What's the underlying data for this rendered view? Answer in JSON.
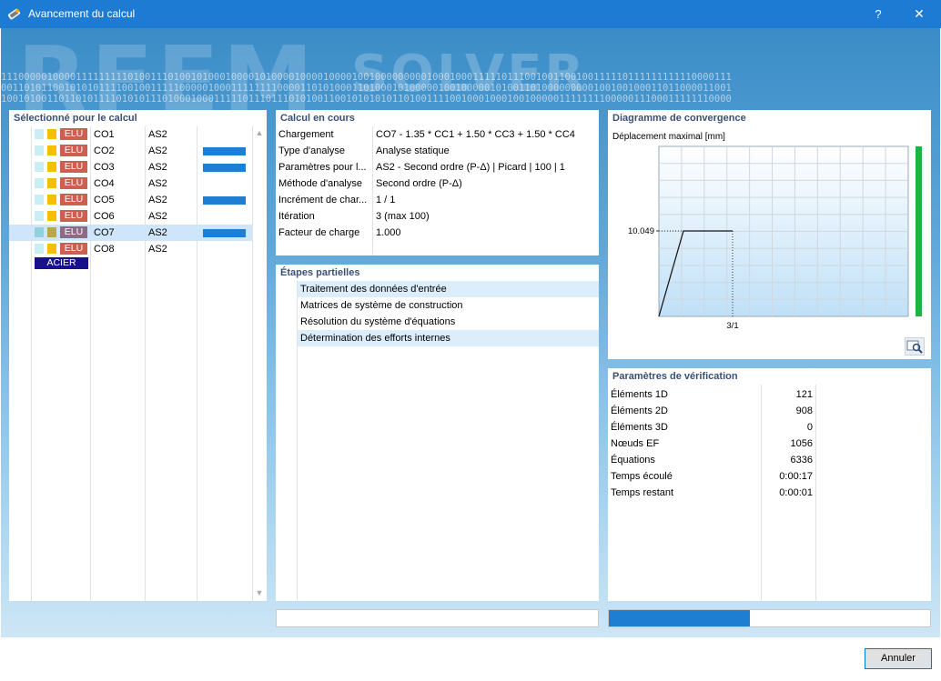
{
  "window": {
    "title": "Avancement du calcul",
    "help": "?",
    "close": "✕"
  },
  "background": {
    "logo_left": "RFEM",
    "logo_right": "SOLVER",
    "binary_lines": [
      "1110000010000111111111010011101001010001000010100001000010000100100000000010001000111110111001001100100111110111111111110000111",
      "0011010110010101011110010011111000001000111111110000110101000110100010100000100100000101001101000000000100100100011011000011001",
      "1001010011011010111101010111010001000111110111011101010011001010101011010011110010001000100100000111111110000011100011111110000"
    ]
  },
  "left": {
    "title": "Sélectionné pour le calcul",
    "rows": [
      {
        "badge": "ELU",
        "co": "CO1",
        "as": "AS2",
        "bar": false,
        "selected": false
      },
      {
        "badge": "ELU",
        "co": "CO2",
        "as": "AS2",
        "bar": true,
        "selected": false
      },
      {
        "badge": "ELU",
        "co": "CO3",
        "as": "AS2",
        "bar": true,
        "selected": false
      },
      {
        "badge": "ELU",
        "co": "CO4",
        "as": "AS2",
        "bar": false,
        "selected": false
      },
      {
        "badge": "ELU",
        "co": "CO5",
        "as": "AS2",
        "bar": true,
        "selected": false
      },
      {
        "badge": "ELU",
        "co": "CO6",
        "as": "AS2",
        "bar": false,
        "selected": false
      },
      {
        "badge": "ELU",
        "co": "CO7",
        "as": "AS2",
        "bar": true,
        "selected": true
      },
      {
        "badge": "ELU",
        "co": "CO8",
        "as": "AS2",
        "bar": false,
        "selected": false
      }
    ],
    "material": "ACIER"
  },
  "current": {
    "title": "Calcul en cours",
    "rows": [
      {
        "key": "Chargement",
        "value": "CO7 - 1.35 * CC1 + 1.50 * CC3 + 1.50 * CC4"
      },
      {
        "key": "Type d'analyse",
        "value": "Analyse statique"
      },
      {
        "key": "Paramètres pour l...",
        "value": "AS2 - Second ordre (P-Δ) | Picard | 100 | 1"
      },
      {
        "key": "Méthode d'analyse",
        "value": "Second ordre (P-Δ)"
      },
      {
        "key": "Incrément de char...",
        "value": "1 / 1"
      },
      {
        "key": "Itération",
        "value": "3 (max 100)"
      },
      {
        "key": "Facteur de charge",
        "value": "1.000"
      }
    ]
  },
  "steps": {
    "title": "Étapes partielles",
    "items": [
      {
        "label": "Traitement des données d'entrée",
        "highlight": true
      },
      {
        "label": "Matrices de système de construction",
        "highlight": false
      },
      {
        "label": "Résolution du système d'équations",
        "highlight": false
      },
      {
        "label": "Détermination des efforts internes",
        "highlight": true
      }
    ]
  },
  "chart_data": {
    "type": "line",
    "title": "Diagramme de convergence",
    "ylabel": "Déplacement maximal [mm]",
    "x": [
      0,
      1,
      2,
      3
    ],
    "y": [
      0,
      10.049,
      10.049,
      10.049
    ],
    "y_tick_label": "10.049",
    "x_tick_label": "3/1",
    "grid": true,
    "indicator_color": "#1db542",
    "line_color": "#1a1a1a"
  },
  "params": {
    "title": "Paramètres de vérification",
    "rows": [
      {
        "key": "Éléments 1D",
        "value": "121"
      },
      {
        "key": "Éléments 2D",
        "value": "908"
      },
      {
        "key": "Éléments 3D",
        "value": "0"
      },
      {
        "key": "Nœuds EF",
        "value": "1056"
      },
      {
        "key": "Équations",
        "value": "6336"
      },
      {
        "key": "Temps écoulé",
        "value": "0:00:17"
      },
      {
        "key": "Temps restant",
        "value": "0:00:01"
      }
    ]
  },
  "progress": {
    "fraction": 0.44
  },
  "buttons": {
    "cancel": "Annuler"
  },
  "colors": {
    "title_bar": "#1d7bd4",
    "accent_blue": "#1e7fd2",
    "badge_elu": "#cc5f4f",
    "badge_acier": "#18118c"
  }
}
